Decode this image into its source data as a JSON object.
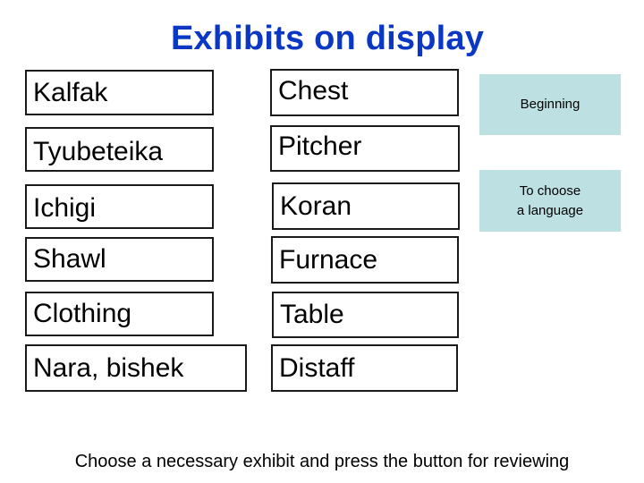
{
  "title": "Exhibits on display",
  "exhibits_left": [
    {
      "label": "Kalfak"
    },
    {
      "label": "Tyubeteika"
    },
    {
      "label": "Ichigi"
    },
    {
      "label": "Shawl"
    },
    {
      "label": "Clothing"
    },
    {
      "label": "Nara, bishek"
    }
  ],
  "exhibits_right": [
    {
      "label": "Chest"
    },
    {
      "label": "Pitcher"
    },
    {
      "label": "Koran"
    },
    {
      "label": "Furnace"
    },
    {
      "label": "Table"
    },
    {
      "label": "Distaff"
    }
  ],
  "buttons": {
    "beginning": "Beginning",
    "choose_language_line1": "To choose",
    "choose_language_line2": "a language"
  },
  "instruction": "Choose a necessary exhibit and press the button for reviewing",
  "colors": {
    "title": "#0a37c4",
    "button_bg": "#bde0e3",
    "border": "#1a1a1a"
  }
}
